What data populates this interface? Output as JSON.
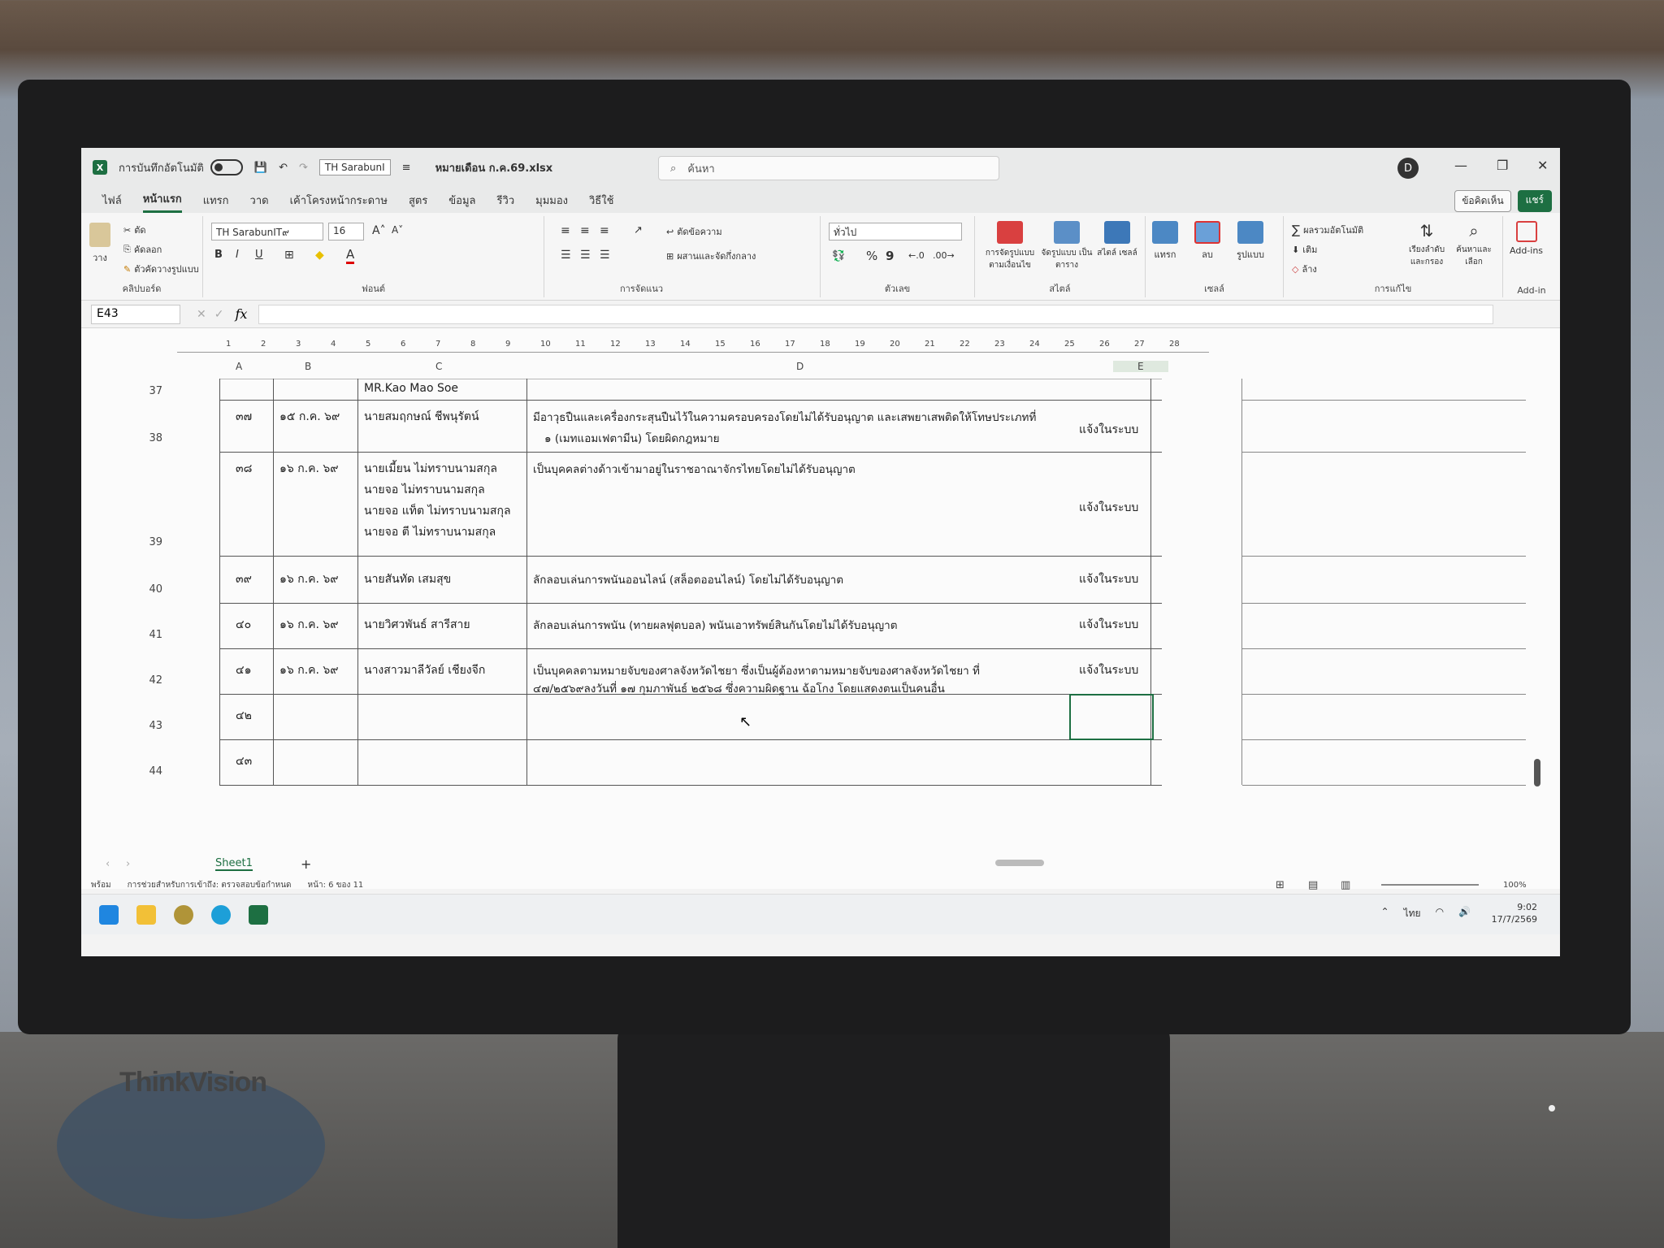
{
  "title_bar": {
    "autosave_label": "การบันทึกอัตโนมัติ",
    "font_name": "TH SarabunI",
    "file_name": "หมายเดือน ก.ค.69.xlsx",
    "search_placeholder": "ค้นหา",
    "user_initial": "D"
  },
  "menu": {
    "tabs": [
      "ไฟล์",
      "หน้าแรก",
      "แทรก",
      "วาด",
      "เค้าโครงหน้ากระดาษ",
      "สูตร",
      "ข้อมูล",
      "รีวิว",
      "มุมมอง",
      "วิธีใช้"
    ],
    "active_tab": "หน้าแรก",
    "comments_button": "ข้อคิดเห็น",
    "share_button": "แชร์"
  },
  "ribbon": {
    "clipboard": {
      "paste": "วาง",
      "cut": "ตัด",
      "copy": "คัดลอก",
      "format_painter": "ตัวคัดวางรูปแบบ",
      "label": "คลิปบอร์ด"
    },
    "font": {
      "name": "TH SarabunIT๙",
      "size": "16",
      "label": "ฟอนต์",
      "bold": "B",
      "italic": "I",
      "underline": "U"
    },
    "alignment": {
      "wrap_text": "ตัดข้อความ",
      "merge_center": "ผสานและจัดกึ่งกลาง",
      "label": "การจัดแนว"
    },
    "number": {
      "format": "ทั่วไป",
      "label": "ตัวเลข",
      "percent": "%",
      "comma": "9"
    },
    "styles": {
      "conditional": "การจัดรูปแบบ ตามเงื่อนไข",
      "format_table": "จัดรูปแบบ เป็นตาราง",
      "cell_styles": "สไตล์ เซลล์",
      "label": "สไตล์"
    },
    "cells": {
      "insert": "แทรก",
      "delete": "ลบ",
      "format": "รูปแบบ",
      "label": "เซลล์"
    },
    "editing": {
      "autosum": "ผลรวมอัตโนมัติ",
      "fill": "เติม",
      "clear": "ล้าง",
      "sort_filter": "เรียงลำดับ และกรอง",
      "find_select": "ค้นหาและ เลือก",
      "label": "การแก้ไข"
    },
    "addins": {
      "button": "Add-ins",
      "label": "Add-in"
    }
  },
  "formula_bar": {
    "name_box": "E43",
    "fx": "fx",
    "content": ""
  },
  "ruler_ticks": [
    "1",
    "2",
    "3",
    "4",
    "5",
    "6",
    "7",
    "8",
    "9",
    "10",
    "11",
    "12",
    "13",
    "14",
    "15",
    "16",
    "17",
    "18",
    "19",
    "20",
    "21",
    "22",
    "23",
    "24",
    "25",
    "26",
    "27",
    "28"
  ],
  "columns": [
    "A",
    "B",
    "C",
    "D",
    "E"
  ],
  "rows": [
    {
      "num": "37",
      "a": "",
      "b": "",
      "c": "MR.Kao Mao Soe",
      "d": "",
      "e": ""
    },
    {
      "num": "38",
      "a": "๓๗",
      "b": "๑๕ ก.ค. ๖๙",
      "c": "นายสมฤกษณ์ ชีพนุรัตน์",
      "d1": "มีอาวุธปืนและเครื่องกระสุนปืนไว้ในความครอบครองโดยไม่ได้รับอนุญาต และเสพยาเสพติดให้โทษประเภทที่",
      "d2": "๑ (เมทแอมเฟตามีน) โดยผิดกฎหมาย",
      "e": "แจ้งในระบบ"
    },
    {
      "num": "39",
      "a": "๓๘",
      "b": "๑๖ ก.ค. ๖๙",
      "c1": "นายเมี้ยน ไม่ทราบนามสกุล",
      "c2": "นายจอ ไม่ทราบนามสกุล",
      "c3": "นายจอ แท็ต ไม่ทราบนามสกุล",
      "c4": "นายจอ ตี ไม่ทราบนามสกุล",
      "d": "เป็นบุคคลต่างด้าวเข้ามาอยู่ในราชอาณาจักรไทยโดยไม่ได้รับอนุญาต",
      "e": "แจ้งในระบบ"
    },
    {
      "num": "40",
      "a": "๓๙",
      "b": "๑๖ ก.ค. ๖๙",
      "c": "นายสันทัด เสมสุข",
      "d": "ลักลอบเล่นการพนันออนไลน์ (สล็อตออนไลน์) โดยไม่ได้รับอนุญาต",
      "e": "แจ้งในระบบ"
    },
    {
      "num": "41",
      "a": "๔๐",
      "b": "๑๖ ก.ค. ๖๙",
      "c": "นายวิศวพันธ์ สารีสาย",
      "d": "ลักลอบเล่นการพนัน (ทายผลฟุตบอล) พนันเอาทรัพย์สินกันโดยไม่ได้รับอนุญาต",
      "e": "แจ้งในระบบ"
    },
    {
      "num": "42",
      "a": "๔๑",
      "b": "๑๖ ก.ค. ๖๙",
      "c": "นางสาวมาลีวัลย์ เชียงจีก",
      "d1": "เป็นบุคคลตามหมายจับของศาลจังหวัดไชยา ซึ่งเป็นผู้ต้องหาตามหมายจับของศาลจังหวัดไชยา ที่",
      "d2": "๔๗/๒๕๖๙ลงวันที่ ๑๗ กุมภาพันธ์ ๒๕๖๘ ซึ่งความผิดฐาน ฉ้อโกง โดยแสดงตนเป็นคนอื่น",
      "e": "แจ้งในระบบ"
    },
    {
      "num": "43",
      "a": "๔๒",
      "b": "",
      "c": "",
      "d": "",
      "e": ""
    },
    {
      "num": "44",
      "a": "๔๓",
      "b": "",
      "c": "",
      "d": "",
      "e": ""
    }
  ],
  "sheet_tabs": {
    "active": "Sheet1",
    "add": "+"
  },
  "status_bar": {
    "ready": "พร้อม",
    "accessibility": "การช่วยสำหรับการเข้าถึง: ตรวจสอบข้อกำหนด",
    "page": "หน้า: 6 ของ 11",
    "zoom": "100%"
  },
  "taskbar": {
    "lang": "ไทย",
    "time": "9:02",
    "date": "17/7/2569"
  },
  "monitor_brand": "ThinkVision",
  "colors": {
    "excel_green": "#1d6f42",
    "selection": "#1d6f42"
  }
}
